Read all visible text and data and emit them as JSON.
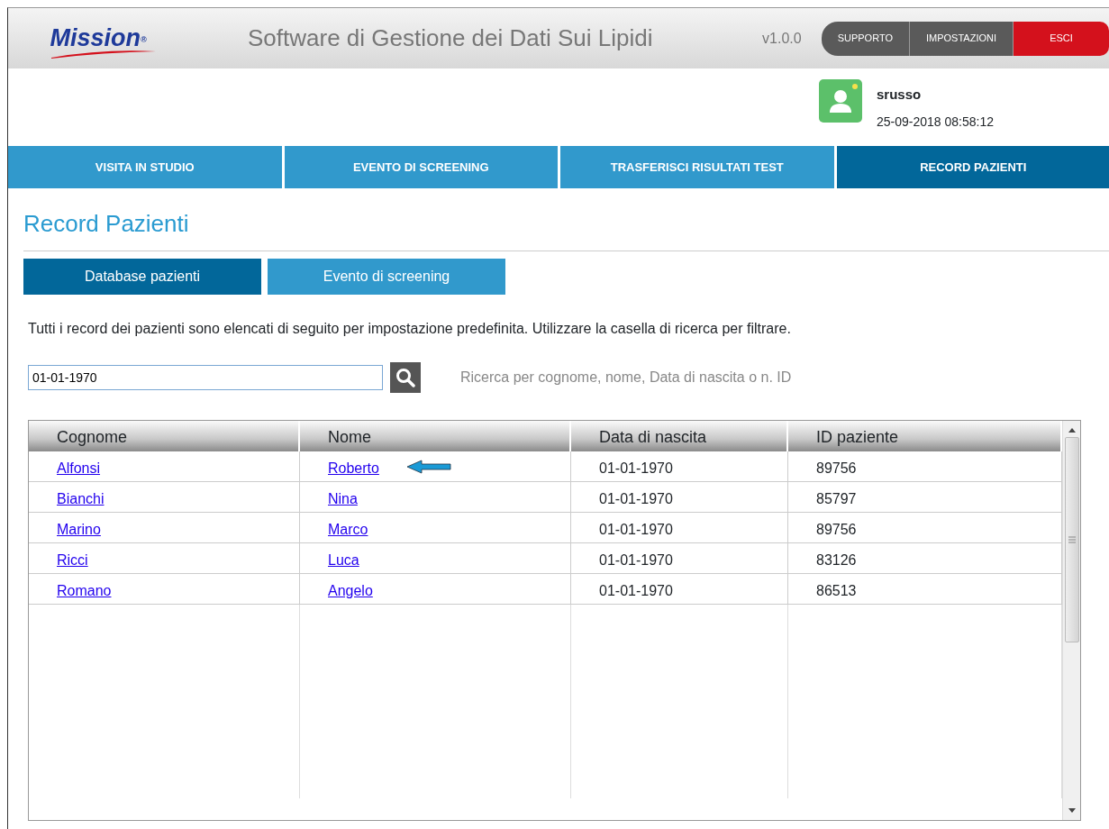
{
  "header": {
    "logo": "Mission$^{®}$",
    "title": "Software di Gestione dei Dati Sui Lipidi",
    "version": "v1.0.0",
    "buttons": [
      {
        "label": "SUPPORTO",
        "kind": "plain"
      },
      {
        "label": "IMPOSTAZIONI",
        "kind": "plain"
      },
      {
        "label": "ESCI",
        "kind": "danger"
      }
    ]
  },
  "user": {
    "name": "srusso",
    "datetime": "25-09-2018 08:58:12"
  },
  "nav_tabs": [
    {
      "label": "VISITA IN STUDIO",
      "selected": false
    },
    {
      "label": "EVENTO DI SCREENING",
      "selected": false
    },
    {
      "label": "TRASFERISCI RISULTATI TEST",
      "selected": false
    },
    {
      "label": "RECORD PAZIENTI",
      "selected": true
    }
  ],
  "page_title": "Record Pazienti",
  "sub_tabs": [
    {
      "label": "Database pazienti",
      "selected": true
    },
    {
      "label": "Evento di screening",
      "selected": false
    }
  ],
  "description": "Tutti i record dei pazienti sono elencati di seguito per impostazione predefinita. Utilizzare la casella di ricerca per filtrare.",
  "search": {
    "value": "01-01-1970",
    "hint": "Ricerca per cognome, nome, Data di nascita o n. ID"
  },
  "table": {
    "columns": [
      "Cognome",
      "Nome",
      "Data di nascita",
      "ID paziente"
    ],
    "rows": [
      {
        "cells": [
          "Alfonsi",
          "Roberto",
          "01-01-1970",
          "89756"
        ],
        "pointed": true
      },
      {
        "cells": [
          "Bianchi",
          "Nina",
          "01-01-1970",
          "85797"
        ],
        "pointed": false
      },
      {
        "cells": [
          "Marino",
          "Marco",
          "01-01-1970",
          "89756"
        ],
        "pointed": false
      },
      {
        "cells": [
          "Ricci",
          "Luca",
          "01-01-1970",
          "83126"
        ],
        "pointed": false
      },
      {
        "cells": [
          "Romano",
          "Angelo",
          "01-01-1970",
          "86513"
        ],
        "pointed": false
      }
    ]
  }
}
